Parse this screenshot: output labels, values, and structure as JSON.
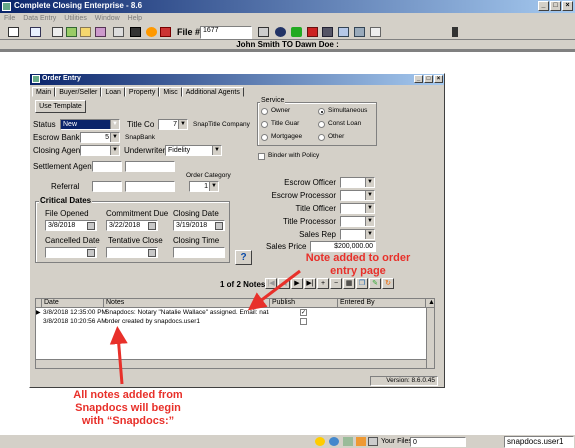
{
  "app": {
    "title": "Complete Closing Enterprise - 8.6"
  },
  "menu": [
    "File",
    "Data Entry",
    "Utilities",
    "Window",
    "Help"
  ],
  "toolbar": {
    "file_no_label": "File #",
    "file_no_value": "1677"
  },
  "file_header": "John Smith TO Dawn Doe :",
  "dialog": {
    "title": "Order Entry",
    "tabs": [
      "Main",
      "Buyer/Seller",
      "Loan",
      "Property",
      "Misc",
      "Additional Agents"
    ],
    "use_template": "Use Template",
    "status_label": "Status",
    "status_value": "New",
    "title_co_label": "Title Co",
    "title_co_value": "7",
    "title_co_name": "SnapTitle Company",
    "escrow_bank_label": "Escrow Bank",
    "escrow_bank_value": "5",
    "escrow_bank_name": "SnapBank",
    "closing_agent_label": "Closing Agent",
    "underwriter_label": "Underwriter",
    "underwriter_value": "Fidelity",
    "settlement_agent_label": "Settlement Agent",
    "referral_label": "Referral",
    "order_category_label": "Order Category",
    "order_category_value": "1",
    "service": {
      "label": "Service",
      "options": [
        {
          "label": "Owner",
          "checked": false
        },
        {
          "label": "Simultaneous",
          "checked": true
        },
        {
          "label": "Title Guar",
          "checked": false
        },
        {
          "label": "Const Loan",
          "checked": false
        },
        {
          "label": "Mortgagee",
          "checked": false
        },
        {
          "label": "Other",
          "checked": false
        }
      ]
    },
    "binder_label": "Binder with Policy",
    "critical_dates": {
      "label": "Critical Dates",
      "file_opened_label": "File Opened",
      "file_opened": "3/8/2018",
      "commitment_due_label": "Commitment Due",
      "commitment_due": "3/22/2018",
      "closing_date_label": "Closing Date",
      "closing_date": "3/19/2018",
      "cancelled_label": "Cancelled Date",
      "tentative_label": "Tentative Close",
      "closing_time_label": "Closing Time"
    },
    "right_fields": {
      "escrow_officer": "Escrow Officer",
      "escrow_processor": "Escrow Processor",
      "title_officer": "Title Officer",
      "title_processor": "Title Processor",
      "sales_rep": "Sales Rep",
      "sales_price_label": "Sales Price",
      "sales_price": "$200,000.00"
    },
    "help_button": "?",
    "notes_counter": "1 of 2 Notes",
    "notes_grid": {
      "columns": [
        "Date",
        "Notes",
        "Publish",
        "Entered By"
      ],
      "rows": [
        {
          "date": "3/8/2018 12:35:00 PM",
          "note": "Snapdocs: Notary \"Natalie Wallace\" assigned. Email: natalie@",
          "publish": true
        },
        {
          "date": "3/8/2018 10:20:56 AM",
          "note": "order created by snapdocs.user1",
          "publish": false
        }
      ]
    },
    "version": "Version: 8.6.0.45"
  },
  "annotations": {
    "top": "Note added to order\nentry page",
    "bottom": "All notes added from\nSnapdocs will begin\nwith “Snapdocs:”"
  },
  "statusbar": {
    "your_files_label": "Your Files",
    "your_files_value": "0",
    "user": "snapdocs.user1"
  },
  "colors": {
    "title_gradient_start": "#0a246a",
    "annotation": "#e8302a",
    "face": "#d4d0c8"
  }
}
